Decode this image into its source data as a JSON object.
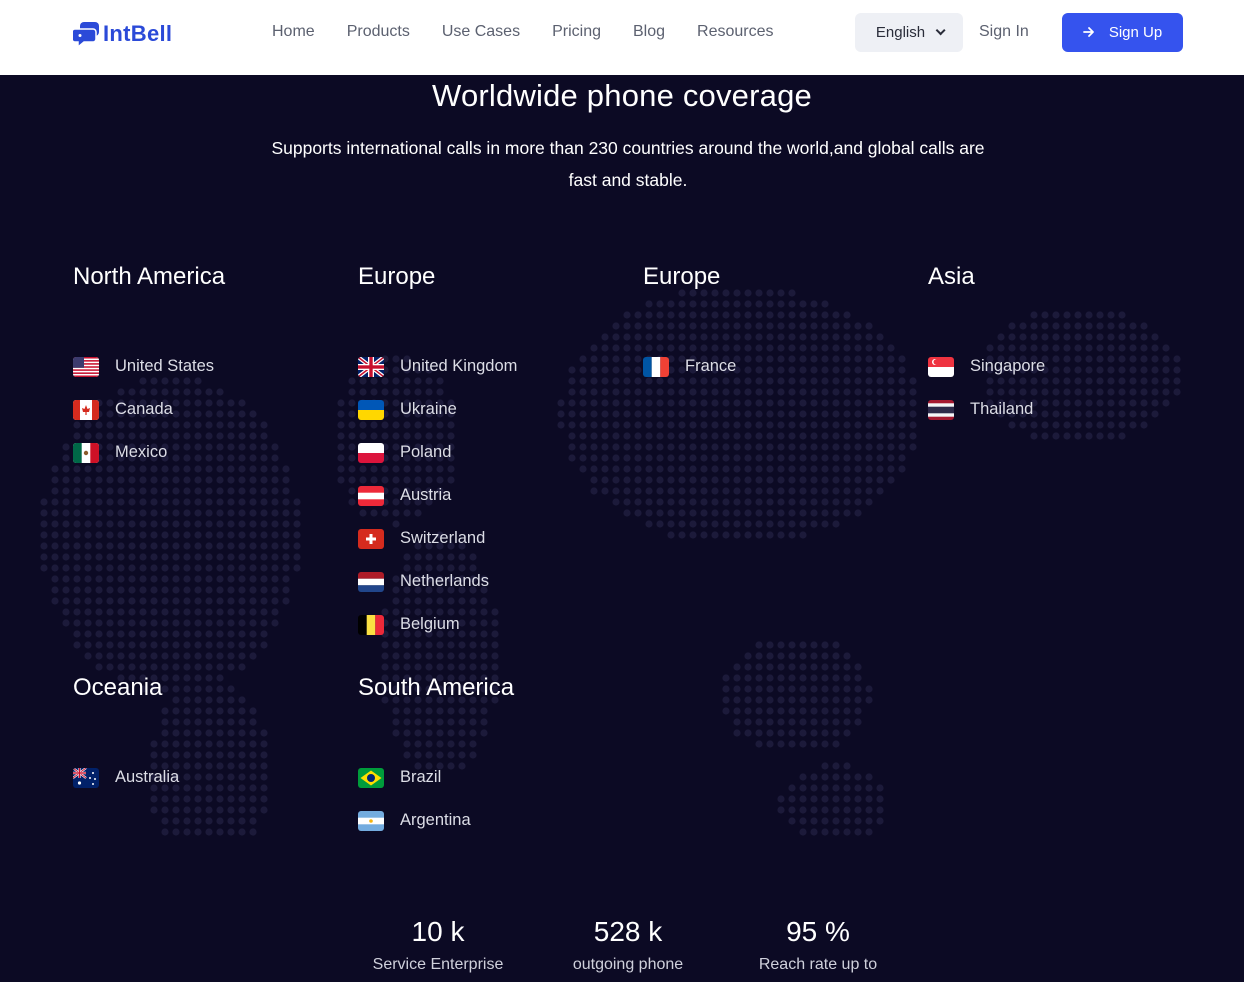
{
  "brand": {
    "name": "IntBell",
    "color": "#2b4ad8"
  },
  "nav": {
    "items": [
      "Home",
      "Products",
      "Use Cases",
      "Pricing",
      "Blog",
      "Resources"
    ]
  },
  "header": {
    "language": "English",
    "sign_in": "Sign In",
    "sign_up": "Sign Up",
    "accent": "#3553ee"
  },
  "hero": {
    "title": "Worldwide phone coverage",
    "subtitle": "Supports international calls in more than 230 countries around the world,and global calls are fast and stable."
  },
  "regions": [
    {
      "name": "North America",
      "countries": [
        {
          "name": "United States",
          "flag": "us-flag-icon"
        },
        {
          "name": "Canada",
          "flag": "ca-flag-icon"
        },
        {
          "name": "Mexico",
          "flag": "mx-flag-icon"
        }
      ]
    },
    {
      "name": "Europe",
      "countries": [
        {
          "name": "United Kingdom",
          "flag": "gb-flag-icon"
        },
        {
          "name": "Ukraine",
          "flag": "ua-flag-icon"
        },
        {
          "name": "Poland",
          "flag": "pl-flag-icon"
        },
        {
          "name": "Austria",
          "flag": "at-flag-icon"
        },
        {
          "name": "Switzerland",
          "flag": "ch-flag-icon"
        },
        {
          "name": "Netherlands",
          "flag": "nl-flag-icon"
        },
        {
          "name": "Belgium",
          "flag": "be-flag-icon"
        }
      ]
    },
    {
      "name": "Europe",
      "countries": [
        {
          "name": "France",
          "flag": "fr-flag-icon"
        }
      ]
    },
    {
      "name": "Asia",
      "countries": [
        {
          "name": "Singapore",
          "flag": "sg-flag-icon"
        },
        {
          "name": "Thailand",
          "flag": "th-flag-icon"
        }
      ]
    },
    {
      "name": "Oceania",
      "countries": [
        {
          "name": "Australia",
          "flag": "au-flag-icon"
        }
      ]
    },
    {
      "name": "South America",
      "countries": [
        {
          "name": "Brazil",
          "flag": "br-flag-icon"
        },
        {
          "name": "Argentina",
          "flag": "ar-flag-icon"
        }
      ]
    }
  ],
  "stats": [
    {
      "value": "10 k",
      "label": "Service Enterprise"
    },
    {
      "value": "528 k",
      "label": "outgoing phone"
    },
    {
      "value": "95 %",
      "label": "Reach rate up to"
    }
  ],
  "colors": {
    "background": "#0c0a24",
    "map_dots": "#1c1a3a"
  }
}
